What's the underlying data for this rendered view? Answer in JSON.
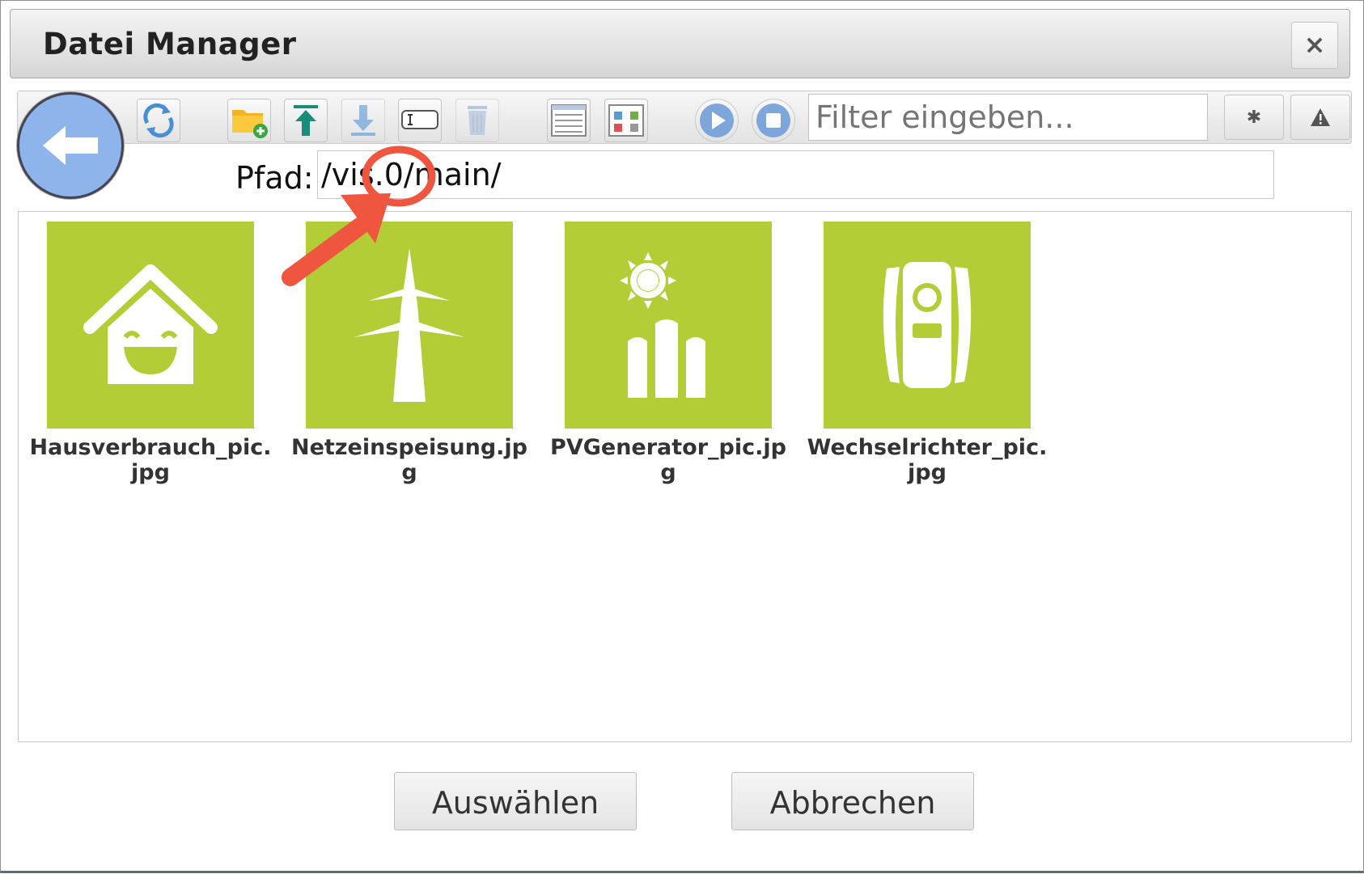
{
  "dialog": {
    "title": "Datei Manager",
    "close_glyph": "×"
  },
  "toolbar": {
    "buttons": [
      {
        "name": "refresh-icon"
      },
      {
        "name": "new-folder-icon"
      },
      {
        "name": "upload-icon"
      },
      {
        "name": "download-icon"
      },
      {
        "name": "rename-icon"
      },
      {
        "name": "delete-icon"
      },
      {
        "name": "list-view-icon"
      },
      {
        "name": "tile-view-icon"
      },
      {
        "name": "play-icon"
      },
      {
        "name": "stop-icon"
      },
      {
        "name": "gear-icon"
      },
      {
        "name": "warning-icon"
      }
    ],
    "filter_placeholder": "Filter eingeben..."
  },
  "path": {
    "label": "Pfad:",
    "value": "/vis.0/main/"
  },
  "files": [
    {
      "name": "Hausverbrauch_pic.jpg",
      "icon": "smiling-house-icon"
    },
    {
      "name": "Netzeinspeisung.jpg",
      "icon": "power-pylon-icon"
    },
    {
      "name": "PVGenerator_pic.jpg",
      "icon": "sun-bars-icon"
    },
    {
      "name": "Wechselrichter_pic.jpg",
      "icon": "inverter-icon"
    }
  ],
  "actions": {
    "select_label": "Auswählen",
    "cancel_label": "Abbrechen"
  },
  "colors": {
    "thumbnail": "#b3cd37",
    "annotation": "#f0553f",
    "back_button": "#8eb4ec"
  }
}
